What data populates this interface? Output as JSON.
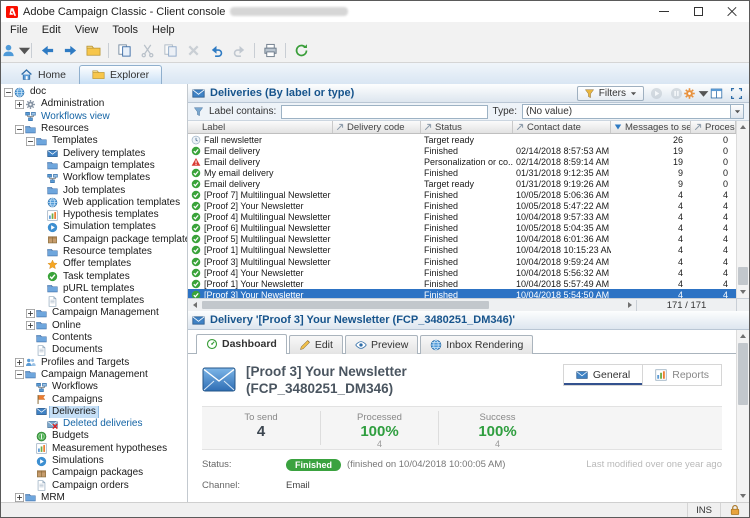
{
  "colors": {
    "accent_blue": "#2d73c4",
    "header_text_blue": "#17548c",
    "success_green": "#2f9e3f",
    "badge_green": "#3aa23f",
    "warning_red": "#d93a32",
    "selected_row": "#2d73c4"
  },
  "window": {
    "title": "Adobe Campaign Classic - Client console",
    "menu": [
      "File",
      "Edit",
      "View",
      "Tools",
      "Help"
    ]
  },
  "toolbar": {
    "items": [
      {
        "name": "user-menu-button",
        "icon": "user",
        "caret": true
      },
      {
        "name": "toolbar-separator",
        "sep": true
      },
      {
        "name": "back-button",
        "icon": "arrow-left"
      },
      {
        "name": "forward-button",
        "icon": "arrow-right"
      },
      {
        "name": "open-button",
        "icon": "folder-yellow"
      },
      {
        "name": "toolbar-separator",
        "sep": true
      },
      {
        "name": "duplicate-button",
        "icon": "copy"
      },
      {
        "name": "cut-button",
        "icon": "scissors",
        "disabled": true
      },
      {
        "name": "copy-button",
        "icon": "copy",
        "disabled": true
      },
      {
        "name": "delete-button",
        "icon": "xmark",
        "disabled": true
      },
      {
        "name": "undo-button",
        "icon": "undo"
      },
      {
        "name": "redo-button",
        "icon": "redo",
        "disabled": true
      },
      {
        "name": "toolbar-separator",
        "sep": true
      },
      {
        "name": "print-button",
        "icon": "printer"
      },
      {
        "name": "toolbar-separator",
        "sep": true
      },
      {
        "name": "refresh-button",
        "icon": "refresh"
      }
    ]
  },
  "nav_tabs": [
    {
      "name": "tab-home",
      "label": "Home",
      "icon": "home"
    },
    {
      "name": "tab-explorer",
      "label": "Explorer",
      "icon": "folder-yellow",
      "active": true
    }
  ],
  "tree": {
    "items": [
      {
        "label": "doc",
        "level": 0,
        "exp": "minus",
        "icon": "globe"
      },
      {
        "label": "Administration",
        "level": 1,
        "exp": "plus",
        "icon": "gear"
      },
      {
        "label": "Workflows view",
        "level": 1,
        "icon": "workflow",
        "link": true
      },
      {
        "label": "Resources",
        "level": 1,
        "exp": "minus",
        "icon": "folder"
      },
      {
        "label": "Templates",
        "level": 2,
        "exp": "minus",
        "icon": "folder"
      },
      {
        "label": "Delivery templates",
        "level": 3,
        "icon": "envelope"
      },
      {
        "label": "Campaign templates",
        "level": 3,
        "icon": "folder"
      },
      {
        "label": "Workflow templates",
        "level": 3,
        "icon": "workflow"
      },
      {
        "label": "Job templates",
        "level": 3,
        "icon": "folder"
      },
      {
        "label": "Web application templates",
        "level": 3,
        "icon": "globe"
      },
      {
        "label": "Hypothesis templates",
        "level": 3,
        "icon": "chart"
      },
      {
        "label": "Simulation templates",
        "level": 3,
        "icon": "play"
      },
      {
        "label": "Campaign package templates",
        "level": 3,
        "icon": "package"
      },
      {
        "label": "Resource templates",
        "level": 3,
        "icon": "folder"
      },
      {
        "label": "Offer templates",
        "level": 3,
        "icon": "star"
      },
      {
        "label": "Task templates",
        "level": 3,
        "icon": "check"
      },
      {
        "label": "pURL templates",
        "level": 3,
        "icon": "folder"
      },
      {
        "label": "Content templates",
        "level": 3,
        "icon": "document"
      },
      {
        "label": "Campaign Management",
        "level": 2,
        "exp": "plus",
        "icon": "folder"
      },
      {
        "label": "Online",
        "level": 2,
        "exp": "plus",
        "icon": "folder"
      },
      {
        "label": "Contents",
        "level": 2,
        "icon": "folder"
      },
      {
        "label": "Documents",
        "level": 2,
        "icon": "document"
      },
      {
        "label": "Profiles and Targets",
        "level": 1,
        "exp": "plus",
        "icon": "users"
      },
      {
        "label": "Campaign Management",
        "level": 1,
        "exp": "minus",
        "icon": "folder"
      },
      {
        "label": "Workflows",
        "level": 2,
        "icon": "workflow"
      },
      {
        "label": "Campaigns",
        "level": 2,
        "icon": "flag"
      },
      {
        "label": "Deliveries",
        "level": 2,
        "icon": "envelope",
        "selected": true
      },
      {
        "label": "Deleted deliveries",
        "level": 3,
        "icon": "envelope-x",
        "link": true
      },
      {
        "label": "Budgets",
        "level": 2,
        "icon": "budget"
      },
      {
        "label": "Measurement hypotheses",
        "level": 2,
        "icon": "chart"
      },
      {
        "label": "Simulations",
        "level": 2,
        "icon": "play"
      },
      {
        "label": "Campaign packages",
        "level": 2,
        "icon": "package"
      },
      {
        "label": "Campaign orders",
        "level": 2,
        "icon": "document"
      },
      {
        "label": "MRM",
        "level": 1,
        "exp": "plus",
        "icon": "folder"
      }
    ]
  },
  "list_panel": {
    "title": "Deliveries (By label or type)",
    "filters_label": "Filters",
    "buttons": [
      {
        "name": "start-button",
        "icon": "play-circle",
        "disabled": true
      },
      {
        "name": "stop-button",
        "icon": "pause-circle",
        "disabled": true
      },
      {
        "name": "configure-button",
        "icon": "gear-orange",
        "caret": true
      },
      {
        "name": "layout-button",
        "icon": "columns"
      },
      {
        "name": "fullscreen-button",
        "icon": "fullscreen"
      }
    ],
    "filter_bar": {
      "label_contains": "Label contains:",
      "type_label": "Type:",
      "type_value": "(No value)"
    },
    "columns": [
      {
        "label": "Label"
      },
      {
        "label": "Delivery code",
        "sort": "sort-diag"
      },
      {
        "label": "Status",
        "sort": "sort-diag"
      },
      {
        "label": "Contact date",
        "sort": "sort-diag"
      },
      {
        "label": "Messages to send",
        "sort": "sort-desc"
      },
      {
        "label": "Processed",
        "sort": "sort-diag"
      }
    ],
    "rows": [
      {
        "label": "Fall newsletter",
        "icon": "pending",
        "code": "",
        "status": "Target ready",
        "date": "",
        "to_send": "26",
        "processed": "0"
      },
      {
        "label": "Email delivery",
        "icon": "check",
        "code": "",
        "status": "Finished",
        "date": "02/14/2018 8:57:53 AM",
        "to_send": "19",
        "processed": "0"
      },
      {
        "label": "Email delivery",
        "icon": "warning",
        "code": "",
        "status": "Personalization or co...",
        "date": "02/14/2018 8:59:14 AM",
        "to_send": "19",
        "processed": "0"
      },
      {
        "label": "My email delivery",
        "icon": "check",
        "code": "",
        "status": "Finished",
        "date": "01/31/2018 9:12:35 AM",
        "to_send": "9",
        "processed": "0"
      },
      {
        "label": "Email delivery",
        "icon": "check",
        "code": "",
        "status": "Target ready",
        "date": "01/31/2018 9:19:26 AM",
        "to_send": "9",
        "processed": "0"
      },
      {
        "label": "[Proof 7] Multilingual Newsletter",
        "icon": "check",
        "code": "",
        "status": "Finished",
        "date": "10/05/2018 5:06:36 AM",
        "to_send": "4",
        "processed": "4"
      },
      {
        "label": "[Proof 2] Your Newsletter",
        "icon": "check",
        "code": "",
        "status": "Finished",
        "date": "10/05/2018 5:47:22 AM",
        "to_send": "4",
        "processed": "4"
      },
      {
        "label": "[Proof 4] Multilingual Newsletter",
        "icon": "check",
        "code": "",
        "status": "Finished",
        "date": "10/04/2018 9:57:33 AM",
        "to_send": "4",
        "processed": "4"
      },
      {
        "label": "[Proof 6] Multilingual Newsletter",
        "icon": "check",
        "code": "",
        "status": "Finished",
        "date": "10/05/2018 5:04:35 AM",
        "to_send": "4",
        "processed": "4"
      },
      {
        "label": "[Proof 5] Multilingual Newsletter",
        "icon": "check",
        "code": "",
        "status": "Finished",
        "date": "10/04/2018 6:01:36 AM",
        "to_send": "4",
        "processed": "4"
      },
      {
        "label": "[Proof 1] Multilingual Newsletter",
        "icon": "check",
        "code": "",
        "status": "Finished",
        "date": "10/04/2018 10:15:23 AM",
        "to_send": "4",
        "processed": "4"
      },
      {
        "label": "[Proof 3] Multilingual Newsletter",
        "icon": "check",
        "code": "",
        "status": "Finished",
        "date": "10/04/2018 9:59:24 AM",
        "to_send": "4",
        "processed": "4"
      },
      {
        "label": "[Proof 4] Your Newsletter",
        "icon": "check",
        "code": "",
        "status": "Finished",
        "date": "10/04/2018 5:56:32 AM",
        "to_send": "4",
        "processed": "4"
      },
      {
        "label": "[Proof 1] Your Newsletter",
        "icon": "check",
        "code": "",
        "status": "Finished",
        "date": "10/04/2018 5:57:49 AM",
        "to_send": "4",
        "processed": "4"
      },
      {
        "label": "[Proof 3] Your Newsletter",
        "icon": "check",
        "code": "",
        "status": "Finished",
        "date": "10/04/2018 5:54:50 AM",
        "to_send": "4",
        "processed": "4",
        "selected": true
      }
    ],
    "pagination": "171 / 171"
  },
  "detail_panel": {
    "header_title": "Delivery '[Proof 3] Your Newsletter (FCP_3480251_DM346)'",
    "tabs": [
      {
        "name": "tab-dashboard",
        "label": "Dashboard",
        "icon": "gauge",
        "active": true
      },
      {
        "name": "tab-edit",
        "label": "Edit",
        "icon": "pencil"
      },
      {
        "name": "tab-preview",
        "label": "Preview",
        "icon": "eye"
      },
      {
        "name": "tab-inbox-rendering",
        "label": "Inbox Rendering",
        "icon": "globe"
      }
    ],
    "title_line1": "[Proof 3] Your Newsletter",
    "title_line2": "(FCP_3480251_DM346)",
    "side_tabs": [
      {
        "name": "tab-general",
        "label": "General",
        "icon": "envelope",
        "active": true
      },
      {
        "name": "tab-reports",
        "label": "Reports",
        "icon": "chart"
      }
    ],
    "stats": [
      {
        "label": "To send",
        "value": "4"
      },
      {
        "label": "Processed",
        "value": "100%",
        "sub": "4",
        "emph": true
      },
      {
        "label": "Success",
        "value": "100%",
        "sub": "4",
        "emph": true
      }
    ],
    "status_label": "Status:",
    "status_badge": "Finished",
    "status_detail": "(finished on 10/04/2018 10:00:05 AM)",
    "last_modified": "Last modified over one year ago",
    "channel_label": "Channel:",
    "channel_value": "Email"
  },
  "status_bar": {
    "ins": "INS"
  }
}
